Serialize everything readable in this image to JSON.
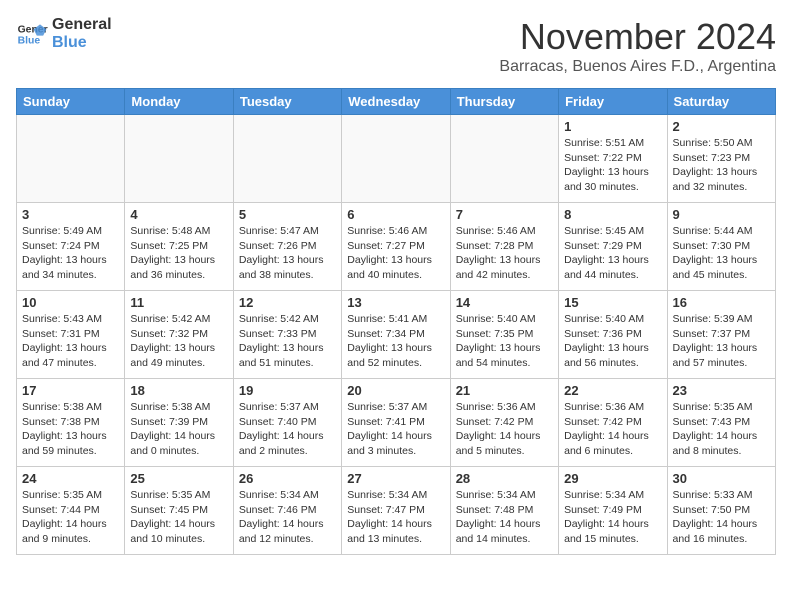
{
  "logo": {
    "line1": "General",
    "line2": "Blue"
  },
  "title": "November 2024",
  "subtitle": "Barracas, Buenos Aires F.D., Argentina",
  "weekdays": [
    "Sunday",
    "Monday",
    "Tuesday",
    "Wednesday",
    "Thursday",
    "Friday",
    "Saturday"
  ],
  "weeks": [
    [
      {
        "day": "",
        "info": ""
      },
      {
        "day": "",
        "info": ""
      },
      {
        "day": "",
        "info": ""
      },
      {
        "day": "",
        "info": ""
      },
      {
        "day": "",
        "info": ""
      },
      {
        "day": "1",
        "info": "Sunrise: 5:51 AM\nSunset: 7:22 PM\nDaylight: 13 hours\nand 30 minutes."
      },
      {
        "day": "2",
        "info": "Sunrise: 5:50 AM\nSunset: 7:23 PM\nDaylight: 13 hours\nand 32 minutes."
      }
    ],
    [
      {
        "day": "3",
        "info": "Sunrise: 5:49 AM\nSunset: 7:24 PM\nDaylight: 13 hours\nand 34 minutes."
      },
      {
        "day": "4",
        "info": "Sunrise: 5:48 AM\nSunset: 7:25 PM\nDaylight: 13 hours\nand 36 minutes."
      },
      {
        "day": "5",
        "info": "Sunrise: 5:47 AM\nSunset: 7:26 PM\nDaylight: 13 hours\nand 38 minutes."
      },
      {
        "day": "6",
        "info": "Sunrise: 5:46 AM\nSunset: 7:27 PM\nDaylight: 13 hours\nand 40 minutes."
      },
      {
        "day": "7",
        "info": "Sunrise: 5:46 AM\nSunset: 7:28 PM\nDaylight: 13 hours\nand 42 minutes."
      },
      {
        "day": "8",
        "info": "Sunrise: 5:45 AM\nSunset: 7:29 PM\nDaylight: 13 hours\nand 44 minutes."
      },
      {
        "day": "9",
        "info": "Sunrise: 5:44 AM\nSunset: 7:30 PM\nDaylight: 13 hours\nand 45 minutes."
      }
    ],
    [
      {
        "day": "10",
        "info": "Sunrise: 5:43 AM\nSunset: 7:31 PM\nDaylight: 13 hours\nand 47 minutes."
      },
      {
        "day": "11",
        "info": "Sunrise: 5:42 AM\nSunset: 7:32 PM\nDaylight: 13 hours\nand 49 minutes."
      },
      {
        "day": "12",
        "info": "Sunrise: 5:42 AM\nSunset: 7:33 PM\nDaylight: 13 hours\nand 51 minutes."
      },
      {
        "day": "13",
        "info": "Sunrise: 5:41 AM\nSunset: 7:34 PM\nDaylight: 13 hours\nand 52 minutes."
      },
      {
        "day": "14",
        "info": "Sunrise: 5:40 AM\nSunset: 7:35 PM\nDaylight: 13 hours\nand 54 minutes."
      },
      {
        "day": "15",
        "info": "Sunrise: 5:40 AM\nSunset: 7:36 PM\nDaylight: 13 hours\nand 56 minutes."
      },
      {
        "day": "16",
        "info": "Sunrise: 5:39 AM\nSunset: 7:37 PM\nDaylight: 13 hours\nand 57 minutes."
      }
    ],
    [
      {
        "day": "17",
        "info": "Sunrise: 5:38 AM\nSunset: 7:38 PM\nDaylight: 13 hours\nand 59 minutes."
      },
      {
        "day": "18",
        "info": "Sunrise: 5:38 AM\nSunset: 7:39 PM\nDaylight: 14 hours\nand 0 minutes."
      },
      {
        "day": "19",
        "info": "Sunrise: 5:37 AM\nSunset: 7:40 PM\nDaylight: 14 hours\nand 2 minutes."
      },
      {
        "day": "20",
        "info": "Sunrise: 5:37 AM\nSunset: 7:41 PM\nDaylight: 14 hours\nand 3 minutes."
      },
      {
        "day": "21",
        "info": "Sunrise: 5:36 AM\nSunset: 7:42 PM\nDaylight: 14 hours\nand 5 minutes."
      },
      {
        "day": "22",
        "info": "Sunrise: 5:36 AM\nSunset: 7:42 PM\nDaylight: 14 hours\nand 6 minutes."
      },
      {
        "day": "23",
        "info": "Sunrise: 5:35 AM\nSunset: 7:43 PM\nDaylight: 14 hours\nand 8 minutes."
      }
    ],
    [
      {
        "day": "24",
        "info": "Sunrise: 5:35 AM\nSunset: 7:44 PM\nDaylight: 14 hours\nand 9 minutes."
      },
      {
        "day": "25",
        "info": "Sunrise: 5:35 AM\nSunset: 7:45 PM\nDaylight: 14 hours\nand 10 minutes."
      },
      {
        "day": "26",
        "info": "Sunrise: 5:34 AM\nSunset: 7:46 PM\nDaylight: 14 hours\nand 12 minutes."
      },
      {
        "day": "27",
        "info": "Sunrise: 5:34 AM\nSunset: 7:47 PM\nDaylight: 14 hours\nand 13 minutes."
      },
      {
        "day": "28",
        "info": "Sunrise: 5:34 AM\nSunset: 7:48 PM\nDaylight: 14 hours\nand 14 minutes."
      },
      {
        "day": "29",
        "info": "Sunrise: 5:34 AM\nSunset: 7:49 PM\nDaylight: 14 hours\nand 15 minutes."
      },
      {
        "day": "30",
        "info": "Sunrise: 5:33 AM\nSunset: 7:50 PM\nDaylight: 14 hours\nand 16 minutes."
      }
    ]
  ]
}
